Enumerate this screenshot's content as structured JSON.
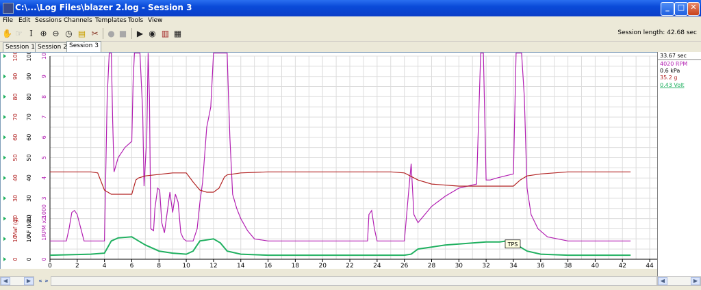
{
  "window": {
    "title": "C:\\...\\Log Files\\blazer 2.log - Session 3",
    "buttons": [
      "_",
      "□",
      "✕"
    ]
  },
  "menu": [
    "File",
    "Edit",
    "Sessions",
    "Channels",
    "Templates",
    "Tools",
    "View"
  ],
  "toolbar": {
    "icons": [
      "hand-icon",
      "select-icon",
      "text-cursor-icon",
      "zoom-in-icon",
      "zoom-out-icon",
      "clock-icon",
      "note-icon",
      "tools-icon",
      "record-icon",
      "stop-icon",
      "play-icon",
      "binoculars-icon",
      "chart-icon",
      "table-icon"
    ],
    "session_length": "Session length:  42.68 sec"
  },
  "tabs": [
    {
      "label": "Session 1",
      "active": false
    },
    {
      "label": "Session 2",
      "active": false
    },
    {
      "label": "Session 3",
      "active": true
    }
  ],
  "readout": [
    {
      "text": "33.67 sec",
      "color": "#000000"
    },
    {
      "text": "4020 RPM",
      "color": "#b21fb2"
    },
    {
      "text": "0.6 kPa",
      "color": "#000000"
    },
    {
      "text": "35.2 g",
      "color": "#b22222"
    },
    {
      "text": "0.43 Volt",
      "color": "#20b060"
    }
  ],
  "chart_data": {
    "type": "line",
    "x_ticks": [
      0,
      2,
      4,
      6,
      8,
      10,
      12,
      14,
      16,
      18,
      20,
      22,
      24,
      26,
      28,
      30,
      32,
      34,
      36,
      38,
      40,
      42,
      44
    ],
    "xlim": [
      0,
      44.6
    ],
    "y_scales": [
      {
        "name": "RPM x 1000",
        "ticks": [
          "0",
          "1",
          "2",
          "3",
          "4",
          "5",
          "6",
          "7",
          "8",
          "9",
          "10"
        ],
        "color": "#b21fb2"
      },
      {
        "name": "AF (kPa)",
        "ticks": [
          "0",
          "10",
          "20",
          "30",
          "40",
          "50",
          "60",
          "70",
          "80",
          "90",
          "100"
        ],
        "color": "#000000"
      },
      {
        "name": "Maf (g)",
        "ticks": [
          "0",
          "10",
          "20",
          "30",
          "40",
          "50",
          "60",
          "70",
          "80",
          "90",
          "100"
        ],
        "color": "#b22222"
      }
    ],
    "ylim": [
      0,
      10
    ],
    "annotation": "TPS",
    "series": [
      {
        "name": "RPM",
        "color": "#b21fb2",
        "x": [
          0,
          1.2,
          1.4,
          1.6,
          1.8,
          2,
          2.5,
          3.5,
          4,
          4.2,
          4.35,
          4.5,
          4.6,
          4.7,
          5,
          5.5,
          6,
          6.1,
          6.2,
          6.3,
          6.5,
          6.6,
          6.8,
          6.9,
          7.1,
          7.2,
          7.3,
          7.4,
          7.6,
          7.7,
          7.9,
          8.05,
          8.2,
          8.4,
          8.6,
          8.8,
          9,
          9.2,
          9.4,
          9.6,
          9.8,
          10,
          10.5,
          10.8,
          11,
          11.2,
          11.5,
          11.8,
          12,
          12.1,
          12.2,
          12.4,
          13,
          13.1,
          13.2,
          13.4,
          13.7,
          14,
          14.5,
          15,
          16,
          18,
          20,
          22,
          23.3,
          23.4,
          23.6,
          23.8,
          24,
          24.1,
          24.3,
          26,
          26.3,
          26.5,
          26.7,
          27,
          27.5,
          28,
          29,
          30,
          31.3,
          31.6,
          31.8,
          32,
          32.3,
          32.8,
          33.4,
          34,
          34.2,
          34.4,
          34.6,
          34.8,
          35,
          35.3,
          35.8,
          36.5,
          38,
          40,
          42,
          42.6
        ],
        "y": [
          0.9,
          0.9,
          1.5,
          2.3,
          2.4,
          2.2,
          0.9,
          0.9,
          0.9,
          8,
          10.2,
          10.2,
          6.8,
          4.3,
          5,
          5.5,
          5.8,
          8.8,
          10.2,
          10.2,
          10.2,
          10.2,
          7.3,
          3.6,
          6,
          10.2,
          8,
          1.5,
          1.4,
          2.5,
          3.5,
          3.4,
          1.8,
          1.3,
          2.3,
          3.3,
          2.3,
          3.2,
          2.8,
          1.3,
          1.0,
          0.9,
          0.9,
          1.5,
          2.8,
          3.8,
          6.5,
          7.5,
          10.2,
          10.2,
          10.2,
          10.2,
          10.2,
          8,
          6,
          3.2,
          2.5,
          2,
          1.4,
          1.0,
          0.9,
          0.9,
          0.9,
          0.9,
          0.9,
          2.2,
          2.4,
          1.5,
          0.9,
          0.9,
          0.9,
          0.9,
          3.2,
          4.7,
          2.2,
          1.8,
          2.2,
          2.6,
          3.1,
          3.5,
          3.7,
          10.2,
          10.2,
          3.9,
          3.9,
          4.0,
          4.1,
          4.2,
          10.2,
          10.2,
          10.2,
          8,
          3.5,
          2.2,
          1.5,
          1.1,
          0.9,
          0.9,
          0.9,
          0.9
        ]
      },
      {
        "name": "Maf",
        "color": "#b22222",
        "x": [
          0,
          3,
          3.5,
          4,
          4.5,
          6,
          6.3,
          6.5,
          7,
          9,
          10,
          10.5,
          11,
          11.5,
          12,
          12.4,
          12.8,
          13,
          14,
          16,
          20,
          25,
          26,
          27,
          28,
          30,
          33,
          34,
          34.5,
          35,
          36,
          38,
          42.6
        ],
        "y": [
          4.3,
          4.3,
          4.25,
          3.4,
          3.2,
          3.2,
          3.9,
          4.0,
          4.1,
          4.25,
          4.25,
          3.8,
          3.4,
          3.3,
          3.3,
          3.5,
          4.05,
          4.15,
          4.25,
          4.3,
          4.3,
          4.3,
          4.25,
          3.9,
          3.7,
          3.6,
          3.6,
          3.6,
          3.9,
          4.1,
          4.2,
          4.3,
          4.3
        ]
      },
      {
        "name": "TPS",
        "color": "#20b060",
        "x": [
          0,
          3,
          4,
          4.5,
          5,
          6,
          6.5,
          7,
          8,
          9,
          10,
          10.5,
          11,
          12,
          12.5,
          13,
          14,
          16,
          18,
          20,
          22,
          24,
          26,
          26.5,
          27,
          28,
          29,
          30,
          31,
          32,
          33,
          33.5,
          34,
          35,
          36,
          38,
          40,
          42.6
        ],
        "y": [
          0.2,
          0.25,
          0.3,
          0.9,
          1.05,
          1.1,
          0.9,
          0.7,
          0.4,
          0.3,
          0.25,
          0.4,
          0.9,
          1.0,
          0.8,
          0.4,
          0.25,
          0.2,
          0.2,
          0.2,
          0.2,
          0.2,
          0.2,
          0.25,
          0.5,
          0.6,
          0.7,
          0.75,
          0.8,
          0.85,
          0.85,
          0.9,
          0.8,
          0.4,
          0.25,
          0.2,
          0.2,
          0.2
        ]
      }
    ]
  }
}
